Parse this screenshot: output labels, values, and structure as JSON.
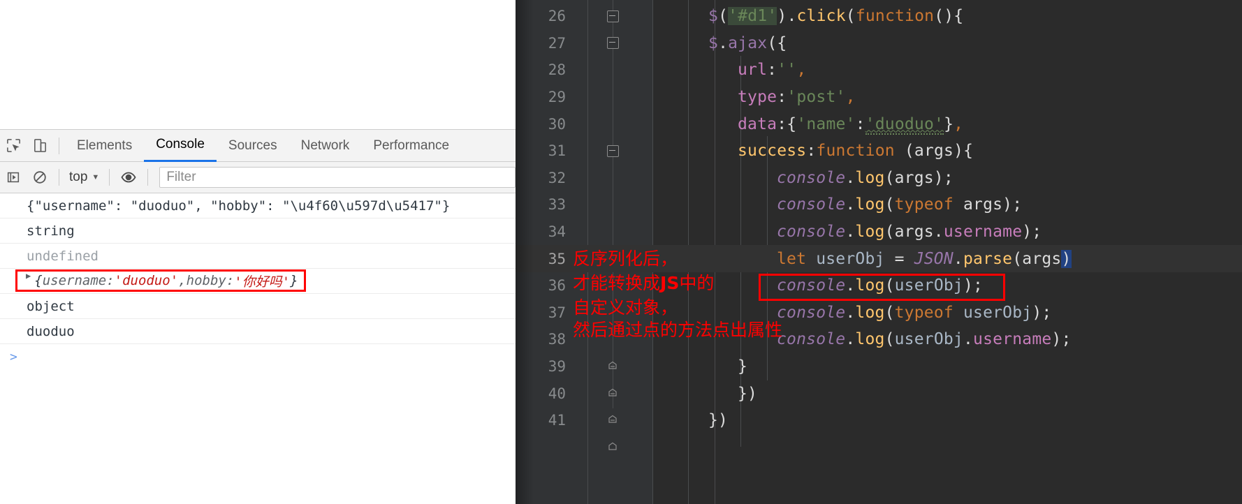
{
  "devtools": {
    "icons": {
      "inspect": "inspect-element-icon",
      "device": "device-toolbar-icon",
      "execute": "execute-icon",
      "clear": "clear-console-icon",
      "eye": "eye-icon"
    },
    "tabs": [
      {
        "label": "Elements",
        "active": false
      },
      {
        "label": "Console",
        "active": true
      },
      {
        "label": "Sources",
        "active": false
      },
      {
        "label": "Network",
        "active": false
      },
      {
        "label": "Performance",
        "active": false
      }
    ],
    "toolbar": {
      "context": "top",
      "filter_placeholder": "Filter",
      "filter_value": ""
    },
    "console_rows": [
      {
        "type": "text",
        "text": "{\"username\": \"duoduo\", \"hobby\": \"\\u4f60\\u597d\\u5417\"}",
        "dim": false,
        "boxed": false,
        "arrow": false
      },
      {
        "type": "text",
        "text": "string",
        "dim": false,
        "boxed": false,
        "arrow": false
      },
      {
        "type": "text",
        "text": "undefined",
        "dim": true,
        "boxed": false,
        "arrow": false
      },
      {
        "type": "object",
        "arrow": true,
        "boxed": true,
        "open_brace": "{",
        "key1": "username",
        "colon1": ": ",
        "val1": "'duoduo'",
        "comma": ", ",
        "key2": "hobby",
        "colon2": ": ",
        "val2": "'你好吗'",
        "close_brace": "}"
      },
      {
        "type": "text",
        "text": "object",
        "dim": false,
        "boxed": false,
        "arrow": false
      },
      {
        "type": "text",
        "text": "duoduo",
        "dim": false,
        "boxed": false,
        "arrow": false
      }
    ],
    "prompt": ">"
  },
  "editor": {
    "lines": [
      {
        "num": "26",
        "fold": "collapse",
        "highlight": false
      },
      {
        "num": "27",
        "fold": "collapse",
        "highlight": false
      },
      {
        "num": "28",
        "fold": "none",
        "highlight": false
      },
      {
        "num": "29",
        "fold": "none",
        "highlight": false
      },
      {
        "num": "30",
        "fold": "none",
        "highlight": false
      },
      {
        "num": "31",
        "fold": "collapse",
        "highlight": false
      },
      {
        "num": "32",
        "fold": "none",
        "highlight": false
      },
      {
        "num": "33",
        "fold": "none",
        "highlight": false
      },
      {
        "num": "34",
        "fold": "none",
        "highlight": false
      },
      {
        "num": "35",
        "fold": "none",
        "highlight": true
      },
      {
        "num": "36",
        "fold": "none",
        "highlight": false
      },
      {
        "num": "37",
        "fold": "none",
        "highlight": false
      },
      {
        "num": "38",
        "fold": "none",
        "highlight": false
      },
      {
        "num": "39",
        "fold": "expand",
        "highlight": false
      },
      {
        "num": "40",
        "fold": "expand",
        "highlight": false
      },
      {
        "num": "41",
        "fold": "expand",
        "highlight": false
      }
    ],
    "code": {
      "l26": "$('#d1').click(function(){",
      "l27": "$.ajax({",
      "l28": "url:'',",
      "l29": "type:'post',",
      "l30": "data:{'name':'duoduo'},",
      "l31": "success:function (args){",
      "l32": "console.log(args);",
      "l33": "console.log(typeof args);",
      "l34": "console.log(args.username);",
      "l35": "let userObj = JSON.parse(args)",
      "l36": "console.log(userObj);",
      "l37": "console.log(typeof userObj);",
      "l38": "console.log(userObj.username);",
      "l39": "}",
      "l40": "})",
      "l41": "})"
    },
    "tokens": {
      "dollar": "$",
      "paren_open": "(",
      "paren_close": ")",
      "sel_d1": "'#d1'",
      "dot": ".",
      "click": "click",
      "function_kw": "function",
      "brace_open": "{",
      "brace_close": "}",
      "ajax": ".ajax",
      "ajax_open": "({",
      "url_key": "url",
      "url_val": "''",
      "comma": ",",
      "type_key": "type",
      "type_val": "'post'",
      "data_key": "data",
      "data_name_key": "'name'",
      "data_name_val": "'duoduo'",
      "success_key": "success",
      "args_param": "(args){",
      "console": "console",
      "log": "log",
      "args": "args",
      "typeof_kw": "typeof",
      "args_username": "args.username",
      "let_kw": "let",
      "userobj": "userObj",
      "equals": "=",
      "json": "JSON",
      "parse": "parse",
      "userobj_username": "userObj.username",
      "semicolon": ";",
      "colon": ":",
      "close_paren_brace": "})"
    }
  },
  "annotations": {
    "note_lines": [
      "反序列化后，",
      "才能转换成JS中的",
      "自定义对象，",
      "然后通过点的方法点出属性"
    ],
    "note_bold_token": "JS",
    "color": "#ff0000"
  }
}
